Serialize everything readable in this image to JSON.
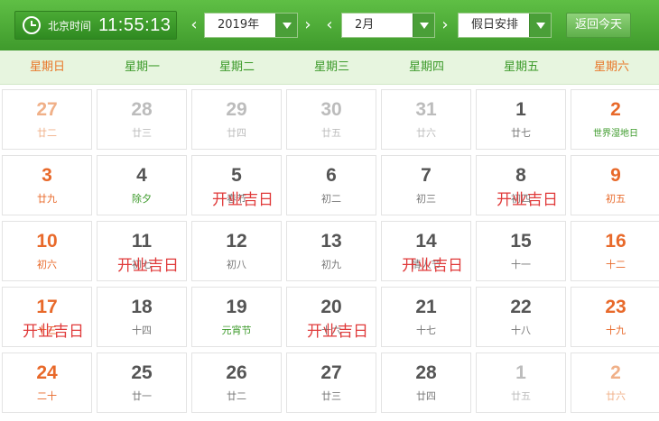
{
  "header": {
    "clock_label": "北京时间",
    "clock_time": "11:55:13",
    "year_value": "2019年",
    "month_value": "2月",
    "holiday_value": "假日安排",
    "today_label": "返回今天",
    "prev_arrow": "‹",
    "next_arrow": "›"
  },
  "weekdays": [
    "星期日",
    "星期一",
    "星期二",
    "星期三",
    "星期四",
    "星期五",
    "星期六"
  ],
  "weeks": [
    [
      {
        "day": "27",
        "lunar": "廿二",
        "other": true
      },
      {
        "day": "28",
        "lunar": "廿三",
        "other": true
      },
      {
        "day": "29",
        "lunar": "廿四",
        "other": true
      },
      {
        "day": "30",
        "lunar": "廿五",
        "other": true
      },
      {
        "day": "31",
        "lunar": "廿六",
        "other": true
      },
      {
        "day": "1",
        "lunar": "廿七",
        "other": false
      },
      {
        "day": "2",
        "lunar": "世界湿地日",
        "other": false,
        "festival": true
      }
    ],
    [
      {
        "day": "3",
        "lunar": "廿九",
        "other": false
      },
      {
        "day": "4",
        "lunar": "除夕",
        "other": false,
        "festival": true
      },
      {
        "day": "5",
        "lunar": "春节",
        "other": false,
        "tag": "开业吉日"
      },
      {
        "day": "6",
        "lunar": "初二",
        "other": false
      },
      {
        "day": "7",
        "lunar": "初三",
        "other": false
      },
      {
        "day": "8",
        "lunar": "初四",
        "other": false,
        "tag": "开业吉日"
      },
      {
        "day": "9",
        "lunar": "初五",
        "other": false
      }
    ],
    [
      {
        "day": "10",
        "lunar": "初六",
        "other": false
      },
      {
        "day": "11",
        "lunar": "初七",
        "other": false,
        "tag": "开业吉日"
      },
      {
        "day": "12",
        "lunar": "初八",
        "other": false
      },
      {
        "day": "13",
        "lunar": "初九",
        "other": false
      },
      {
        "day": "14",
        "lunar": "情人节",
        "other": false,
        "tag": "开业吉日"
      },
      {
        "day": "15",
        "lunar": "十一",
        "other": false
      },
      {
        "day": "16",
        "lunar": "十二",
        "other": false
      }
    ],
    [
      {
        "day": "17",
        "lunar": "十三",
        "other": false,
        "tag": "开业吉日"
      },
      {
        "day": "18",
        "lunar": "十四",
        "other": false
      },
      {
        "day": "19",
        "lunar": "元宵节",
        "other": false,
        "festival": true
      },
      {
        "day": "20",
        "lunar": "十六",
        "other": false,
        "tag": "开业吉日"
      },
      {
        "day": "21",
        "lunar": "十七",
        "other": false
      },
      {
        "day": "22",
        "lunar": "十八",
        "other": false
      },
      {
        "day": "23",
        "lunar": "十九",
        "other": false
      }
    ],
    [
      {
        "day": "24",
        "lunar": "二十",
        "other": false
      },
      {
        "day": "25",
        "lunar": "廿一",
        "other": false
      },
      {
        "day": "26",
        "lunar": "廿二",
        "other": false
      },
      {
        "day": "27",
        "lunar": "廿三",
        "other": false
      },
      {
        "day": "28",
        "lunar": "廿四",
        "other": false
      },
      {
        "day": "1",
        "lunar": "廿五",
        "other": true
      },
      {
        "day": "2",
        "lunar": "廿六",
        "other": true
      }
    ]
  ],
  "colors": {
    "header_green": "#4aaa34",
    "weekend_orange": "#e8692a",
    "tag_red": "#e03a3a",
    "festival_green": "#3c9a2a"
  }
}
